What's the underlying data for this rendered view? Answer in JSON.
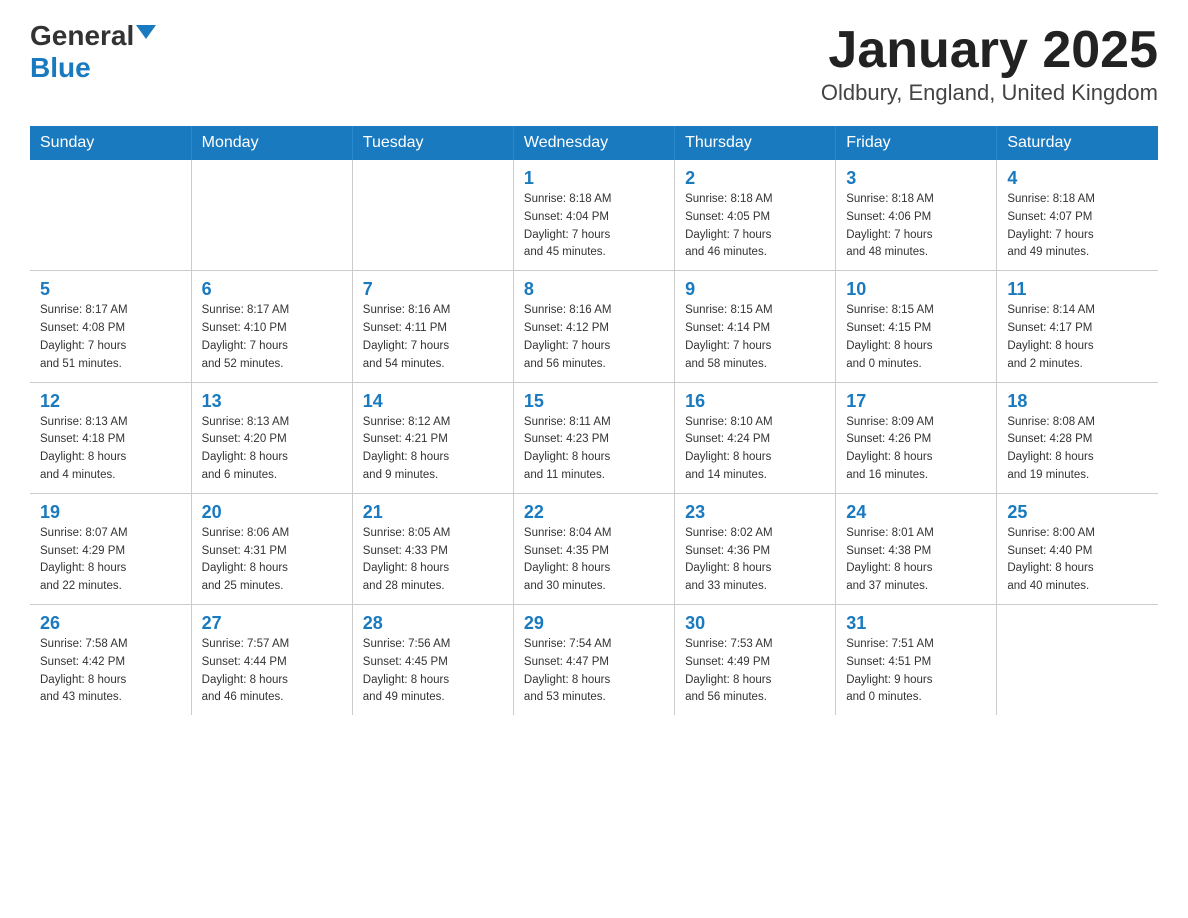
{
  "logo": {
    "general": "General",
    "blue": "Blue"
  },
  "header": {
    "month": "January 2025",
    "location": "Oldbury, England, United Kingdom"
  },
  "days_of_week": [
    "Sunday",
    "Monday",
    "Tuesday",
    "Wednesday",
    "Thursday",
    "Friday",
    "Saturday"
  ],
  "weeks": [
    [
      {
        "day": "",
        "info": ""
      },
      {
        "day": "",
        "info": ""
      },
      {
        "day": "",
        "info": ""
      },
      {
        "day": "1",
        "info": "Sunrise: 8:18 AM\nSunset: 4:04 PM\nDaylight: 7 hours\nand 45 minutes."
      },
      {
        "day": "2",
        "info": "Sunrise: 8:18 AM\nSunset: 4:05 PM\nDaylight: 7 hours\nand 46 minutes."
      },
      {
        "day": "3",
        "info": "Sunrise: 8:18 AM\nSunset: 4:06 PM\nDaylight: 7 hours\nand 48 minutes."
      },
      {
        "day": "4",
        "info": "Sunrise: 8:18 AM\nSunset: 4:07 PM\nDaylight: 7 hours\nand 49 minutes."
      }
    ],
    [
      {
        "day": "5",
        "info": "Sunrise: 8:17 AM\nSunset: 4:08 PM\nDaylight: 7 hours\nand 51 minutes."
      },
      {
        "day": "6",
        "info": "Sunrise: 8:17 AM\nSunset: 4:10 PM\nDaylight: 7 hours\nand 52 minutes."
      },
      {
        "day": "7",
        "info": "Sunrise: 8:16 AM\nSunset: 4:11 PM\nDaylight: 7 hours\nand 54 minutes."
      },
      {
        "day": "8",
        "info": "Sunrise: 8:16 AM\nSunset: 4:12 PM\nDaylight: 7 hours\nand 56 minutes."
      },
      {
        "day": "9",
        "info": "Sunrise: 8:15 AM\nSunset: 4:14 PM\nDaylight: 7 hours\nand 58 minutes."
      },
      {
        "day": "10",
        "info": "Sunrise: 8:15 AM\nSunset: 4:15 PM\nDaylight: 8 hours\nand 0 minutes."
      },
      {
        "day": "11",
        "info": "Sunrise: 8:14 AM\nSunset: 4:17 PM\nDaylight: 8 hours\nand 2 minutes."
      }
    ],
    [
      {
        "day": "12",
        "info": "Sunrise: 8:13 AM\nSunset: 4:18 PM\nDaylight: 8 hours\nand 4 minutes."
      },
      {
        "day": "13",
        "info": "Sunrise: 8:13 AM\nSunset: 4:20 PM\nDaylight: 8 hours\nand 6 minutes."
      },
      {
        "day": "14",
        "info": "Sunrise: 8:12 AM\nSunset: 4:21 PM\nDaylight: 8 hours\nand 9 minutes."
      },
      {
        "day": "15",
        "info": "Sunrise: 8:11 AM\nSunset: 4:23 PM\nDaylight: 8 hours\nand 11 minutes."
      },
      {
        "day": "16",
        "info": "Sunrise: 8:10 AM\nSunset: 4:24 PM\nDaylight: 8 hours\nand 14 minutes."
      },
      {
        "day": "17",
        "info": "Sunrise: 8:09 AM\nSunset: 4:26 PM\nDaylight: 8 hours\nand 16 minutes."
      },
      {
        "day": "18",
        "info": "Sunrise: 8:08 AM\nSunset: 4:28 PM\nDaylight: 8 hours\nand 19 minutes."
      }
    ],
    [
      {
        "day": "19",
        "info": "Sunrise: 8:07 AM\nSunset: 4:29 PM\nDaylight: 8 hours\nand 22 minutes."
      },
      {
        "day": "20",
        "info": "Sunrise: 8:06 AM\nSunset: 4:31 PM\nDaylight: 8 hours\nand 25 minutes."
      },
      {
        "day": "21",
        "info": "Sunrise: 8:05 AM\nSunset: 4:33 PM\nDaylight: 8 hours\nand 28 minutes."
      },
      {
        "day": "22",
        "info": "Sunrise: 8:04 AM\nSunset: 4:35 PM\nDaylight: 8 hours\nand 30 minutes."
      },
      {
        "day": "23",
        "info": "Sunrise: 8:02 AM\nSunset: 4:36 PM\nDaylight: 8 hours\nand 33 minutes."
      },
      {
        "day": "24",
        "info": "Sunrise: 8:01 AM\nSunset: 4:38 PM\nDaylight: 8 hours\nand 37 minutes."
      },
      {
        "day": "25",
        "info": "Sunrise: 8:00 AM\nSunset: 4:40 PM\nDaylight: 8 hours\nand 40 minutes."
      }
    ],
    [
      {
        "day": "26",
        "info": "Sunrise: 7:58 AM\nSunset: 4:42 PM\nDaylight: 8 hours\nand 43 minutes."
      },
      {
        "day": "27",
        "info": "Sunrise: 7:57 AM\nSunset: 4:44 PM\nDaylight: 8 hours\nand 46 minutes."
      },
      {
        "day": "28",
        "info": "Sunrise: 7:56 AM\nSunset: 4:45 PM\nDaylight: 8 hours\nand 49 minutes."
      },
      {
        "day": "29",
        "info": "Sunrise: 7:54 AM\nSunset: 4:47 PM\nDaylight: 8 hours\nand 53 minutes."
      },
      {
        "day": "30",
        "info": "Sunrise: 7:53 AM\nSunset: 4:49 PM\nDaylight: 8 hours\nand 56 minutes."
      },
      {
        "day": "31",
        "info": "Sunrise: 7:51 AM\nSunset: 4:51 PM\nDaylight: 9 hours\nand 0 minutes."
      },
      {
        "day": "",
        "info": ""
      }
    ]
  ]
}
